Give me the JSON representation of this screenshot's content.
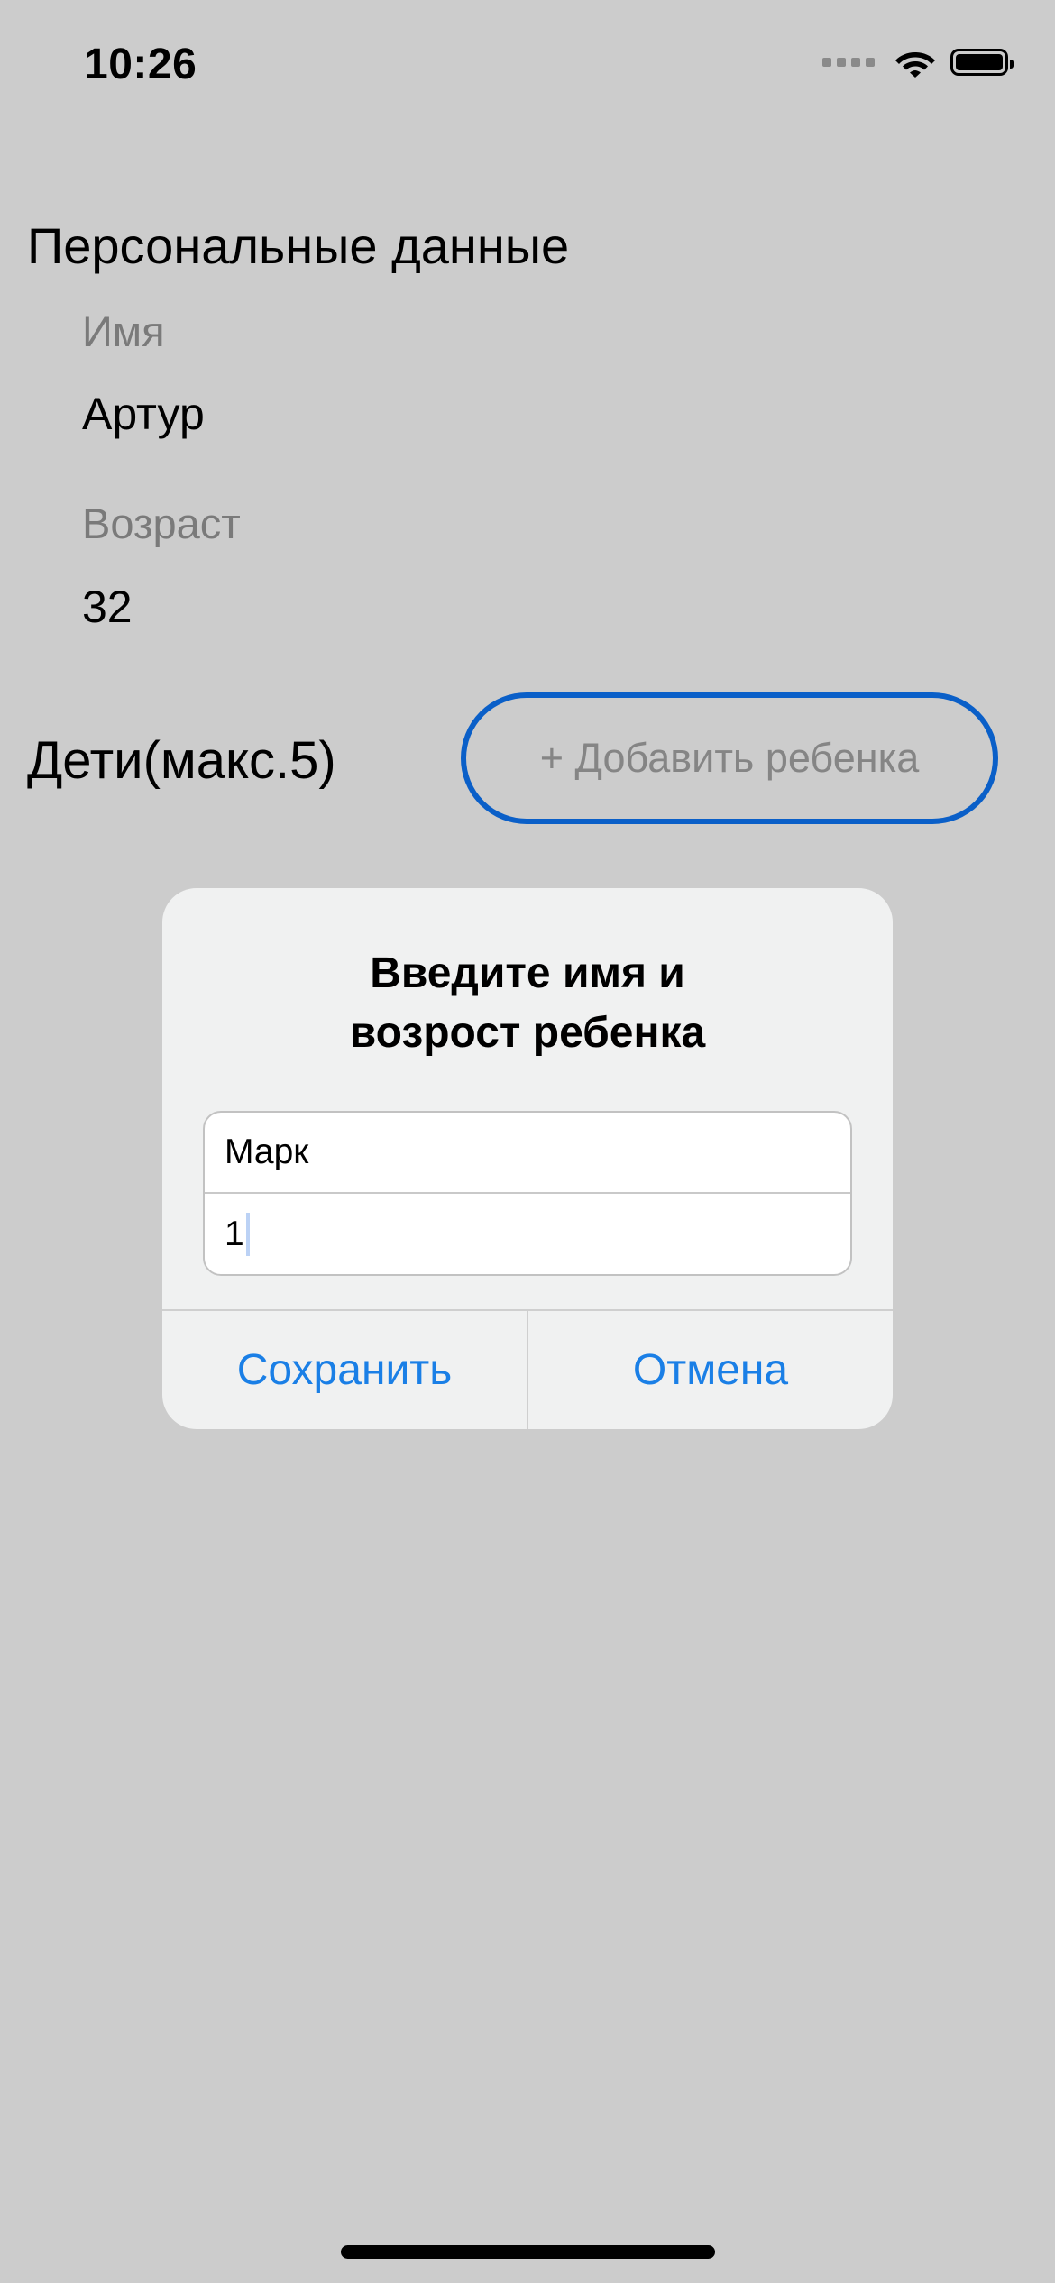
{
  "status_bar": {
    "time": "10:26",
    "icons": [
      "signal-icon",
      "wifi-icon",
      "battery-icon"
    ]
  },
  "personal": {
    "title": "Персональные данные",
    "name_label": "Имя",
    "name_value": "Артур",
    "age_label": "Возраст",
    "age_value": "32"
  },
  "children": {
    "title": "Дети(макс.5)",
    "add_button_label": "+ Добавить ребенка"
  },
  "alert": {
    "title_line1": "Введите имя и",
    "title_line2": "возрост ребенка",
    "name_field_value": "Марк",
    "age_field_value": "1",
    "save_label": "Сохранить",
    "cancel_label": "Отмена"
  },
  "colors": {
    "background": "#cccccc",
    "accent": "#1a7fe6",
    "button_border": "#0a5fc8",
    "dialog_background": "#f0f1f1"
  }
}
